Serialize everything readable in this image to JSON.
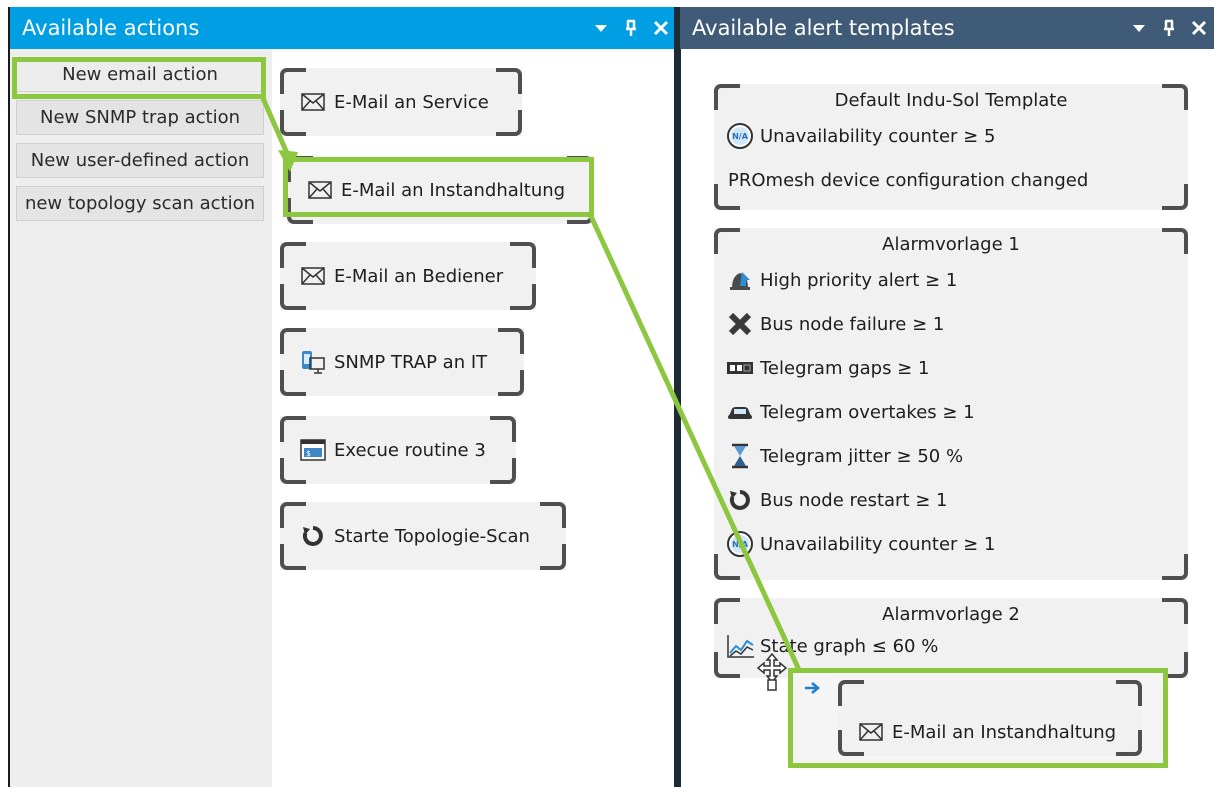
{
  "left_panel": {
    "title": "Available actions",
    "new_buttons": [
      "New email action",
      "New SNMP trap action",
      "New user-defined action",
      "new topology scan action"
    ],
    "actions": [
      {
        "label": "E-Mail an Service",
        "icon": "envelope-icon"
      },
      {
        "label": "E-Mail an Instandhaltung",
        "icon": "envelope-icon"
      },
      {
        "label": "E-Mail an Bediener",
        "icon": "envelope-icon"
      },
      {
        "label": "SNMP TRAP an IT",
        "icon": "snmp-device-icon"
      },
      {
        "label": "Execue routine 3",
        "icon": "terminal-icon"
      },
      {
        "label": "Starte Topologie-Scan",
        "icon": "restart-icon"
      }
    ]
  },
  "right_panel": {
    "title": "Available alert templates",
    "templates": [
      {
        "title": "Default Indu-Sol Template",
        "rows": [
          {
            "icon": "na-icon",
            "text": "Unavailability counter  ≥  5"
          },
          {
            "icon": "",
            "text": "PROmesh device configuration changed"
          }
        ]
      },
      {
        "title": "Alarmvorlage 1",
        "rows": [
          {
            "icon": "bell-arrow-icon",
            "text": "High priority alert  ≥  1"
          },
          {
            "icon": "x-mark-icon",
            "text": "Bus node failure  ≥  1"
          },
          {
            "icon": "telegram-gap-icon",
            "text": "Telegram gaps  ≥  1"
          },
          {
            "icon": "car-icon",
            "text": "Telegram overtakes  ≥  1"
          },
          {
            "icon": "hourglass-icon",
            "text": "Telegram jitter  ≥  50 %"
          },
          {
            "icon": "restart-icon",
            "text": "Bus node restart  ≥  1"
          },
          {
            "icon": "na-icon",
            "text": "Unavailability counter  ≥  1"
          }
        ]
      },
      {
        "title": "Alarmvorlage 2",
        "rows": [
          {
            "icon": "graph-icon",
            "text": "State graph  ≤  60 %"
          }
        ]
      }
    ]
  },
  "drag": {
    "label": "E-Mail an Instandhaltung"
  },
  "colors": {
    "left_titlebar": "#009fe3",
    "right_titlebar": "#3f5b77",
    "highlight": "#8dc63f",
    "bracket": "#4f4f4f",
    "tile_bg": "#f1f1f1"
  }
}
